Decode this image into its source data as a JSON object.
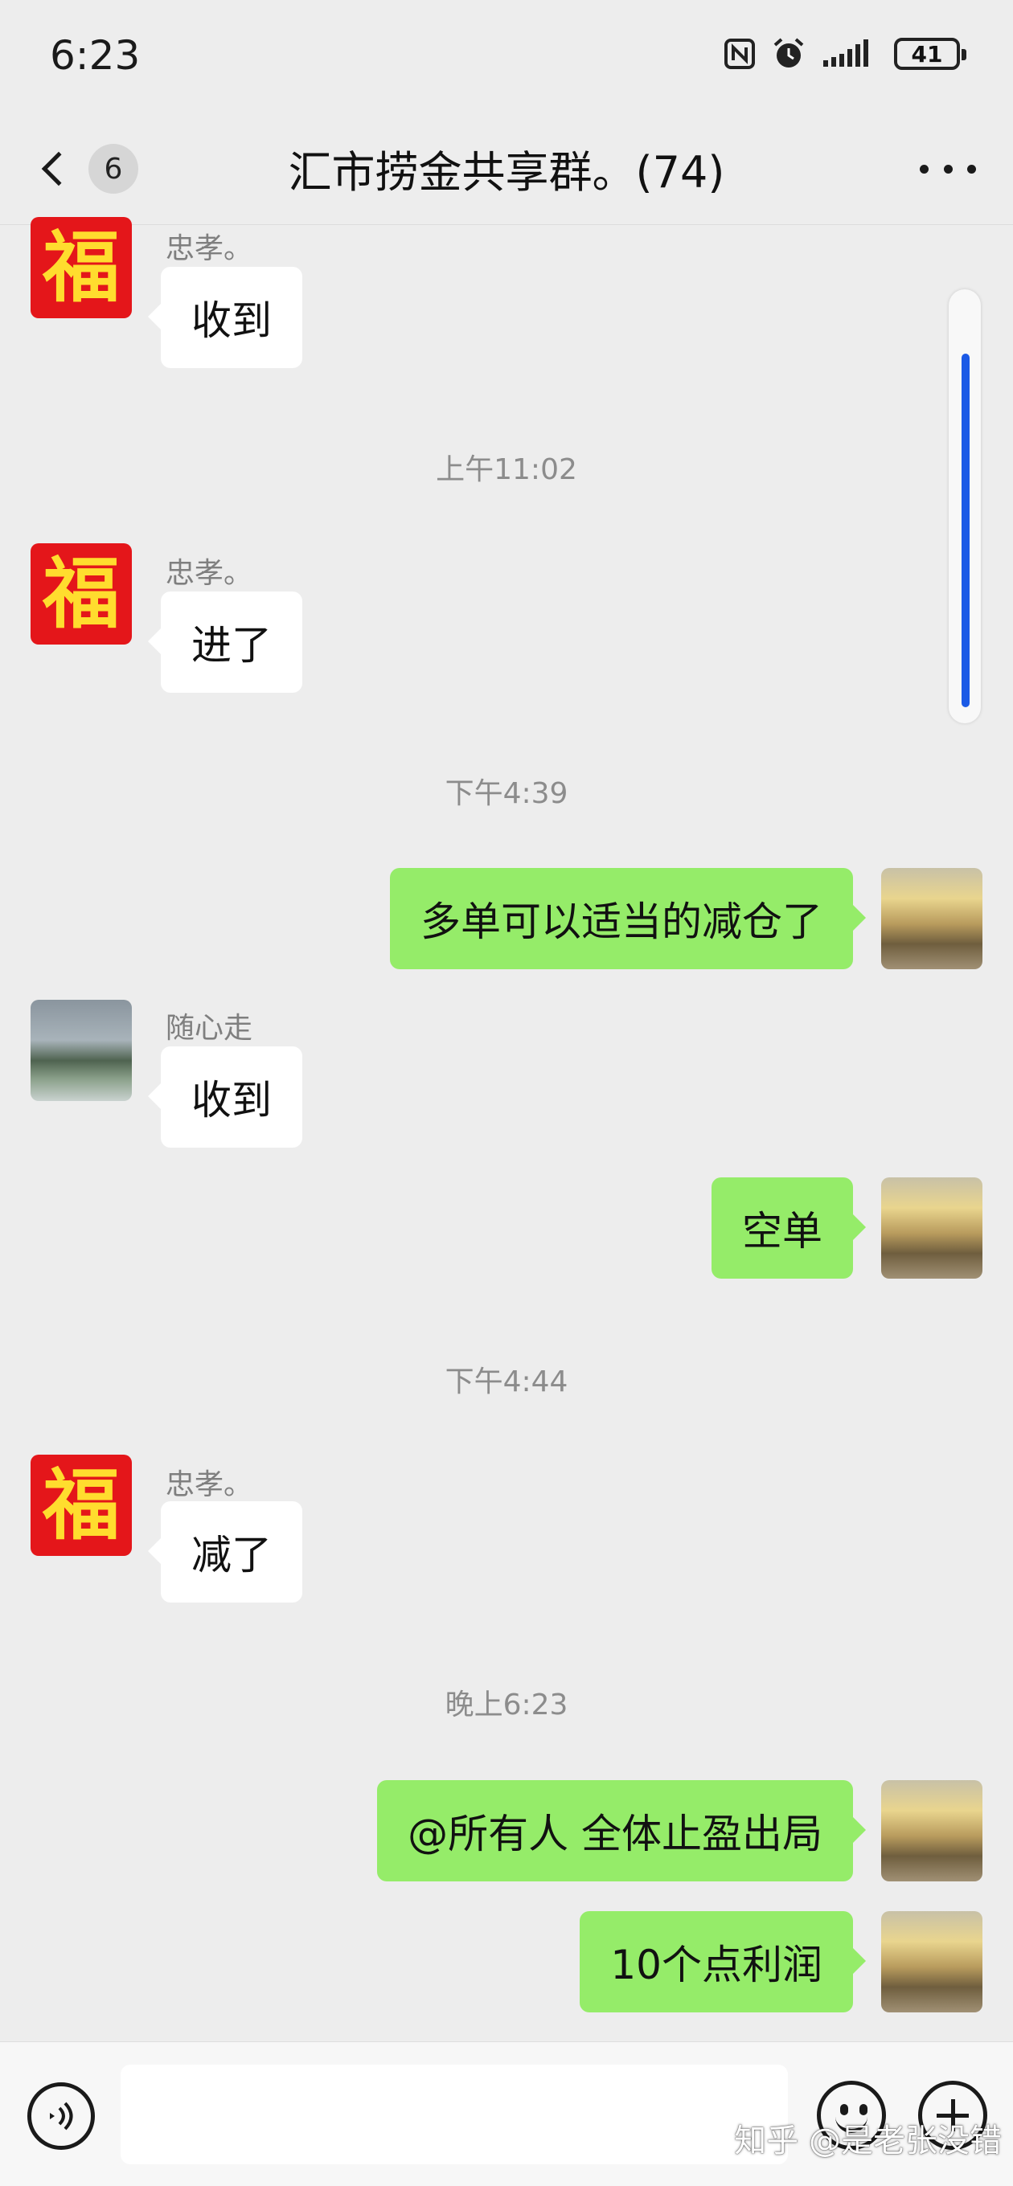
{
  "status_bar": {
    "time": "6:23",
    "battery": "41",
    "icons": [
      "nfc-icon",
      "alarm-icon",
      "signal-icon",
      "battery-icon"
    ]
  },
  "header": {
    "back_icon": "chevron-left-icon",
    "unread_count": "6",
    "title": "汇市捞金共享群。(74)",
    "more_icon": "more-dots-icon"
  },
  "messages": [
    {
      "sender": "忠孝。",
      "avatar": "fu-character-avatar",
      "direction": "in",
      "text": "收到"
    },
    {
      "timestamp": "上午11:02"
    },
    {
      "sender": "忠孝。",
      "avatar": "fu-character-avatar",
      "direction": "in",
      "text": "进了"
    },
    {
      "timestamp": "下午4:39"
    },
    {
      "direction": "out",
      "avatar": "sunset-avatar",
      "text": "多单可以适当的减仓了"
    },
    {
      "sender": "随心走",
      "avatar": "lake-avatar",
      "direction": "in",
      "text": "收到"
    },
    {
      "direction": "out",
      "avatar": "sunset-avatar",
      "text": "空单"
    },
    {
      "timestamp": "下午4:44"
    },
    {
      "sender": "忠孝。",
      "avatar": "fu-character-avatar",
      "direction": "in",
      "text": "减了"
    },
    {
      "timestamp": "晚上6:23"
    },
    {
      "direction": "out",
      "avatar": "sunset-avatar",
      "text": "@所有人  全体止盈出局"
    },
    {
      "direction": "out",
      "avatar": "sunset-avatar",
      "text": "10个点利润"
    }
  ],
  "avatar_glyph": "福",
  "input_bar": {
    "voice_icon": "voice-icon",
    "input_value": "",
    "emoji_icon": "emoji-icon",
    "plus_icon": "plus-icon"
  },
  "watermark": "知乎 @是老张没错",
  "colors": {
    "background": "#ededed",
    "outgoing_bubble": "#95ec69",
    "incoming_bubble": "#ffffff",
    "scroll_indicator": "#1b5ae6",
    "avatar_red": "#e4161a",
    "avatar_gold": "#ffdd2e"
  }
}
